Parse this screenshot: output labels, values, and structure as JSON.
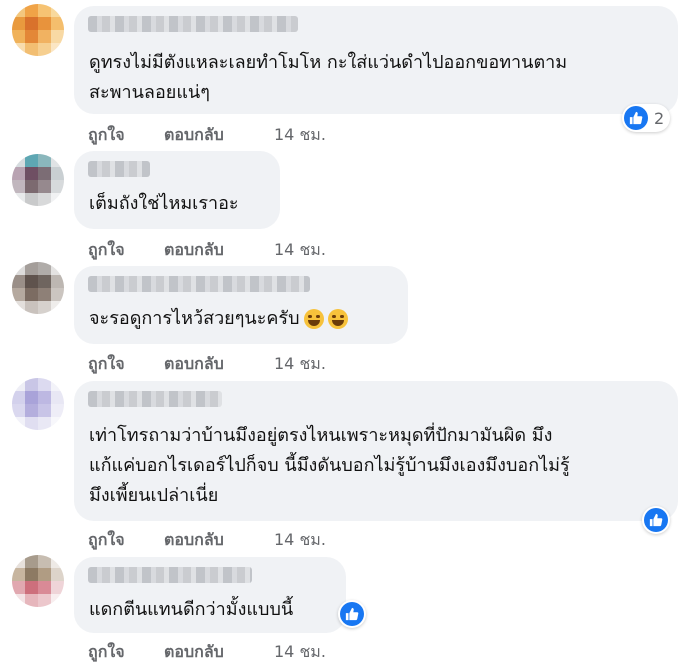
{
  "comments": [
    {
      "text": "ดูทรงไม่มีตังแหละเลยทำโมโห กะใส่แว่นดำไปออกขอทานตาม\nสะพานลอยแน่ๆ",
      "like_label": "ถูกใจ",
      "reply_label": "ตอบกลับ",
      "time": "14 ชม.",
      "reaction_count": "2"
    },
    {
      "text": "เต็มถังใช่ไหมเราอะ",
      "like_label": "ถูกใจ",
      "reply_label": "ตอบกลับ",
      "time": "14 ชม."
    },
    {
      "text": "จะรอดูการไหว้สวยๆนะครับ",
      "like_label": "ถูกใจ",
      "reply_label": "ตอบกลับ",
      "time": "14 ชม."
    },
    {
      "text": "เท่าโทรถามว่าบ้านมึงอยู่ตรงไหนเพราะหมุดที่ปักมามันผิด มึง\nแก้แค่บอกไรเดอร์ไปก็จบ นี้มึงดันบอกไม่รู้บ้านมึงเองมึงบอกไม่รู้\nมึงเพี้ยนเปล่าเนี่ย",
      "like_label": "ถูกใจ",
      "reply_label": "ตอบกลับ",
      "time": "14 ชม."
    },
    {
      "text": "แดกตีนแทนดีกว่ามั้งแบบนี้",
      "like_label": "ถูกใจ",
      "reply_label": "ตอบกลับ",
      "time": "14 ชม."
    }
  ],
  "colors": {
    "bubble": "#f0f2f5",
    "like_blue": "#1877f2",
    "meta": "#65676b"
  }
}
